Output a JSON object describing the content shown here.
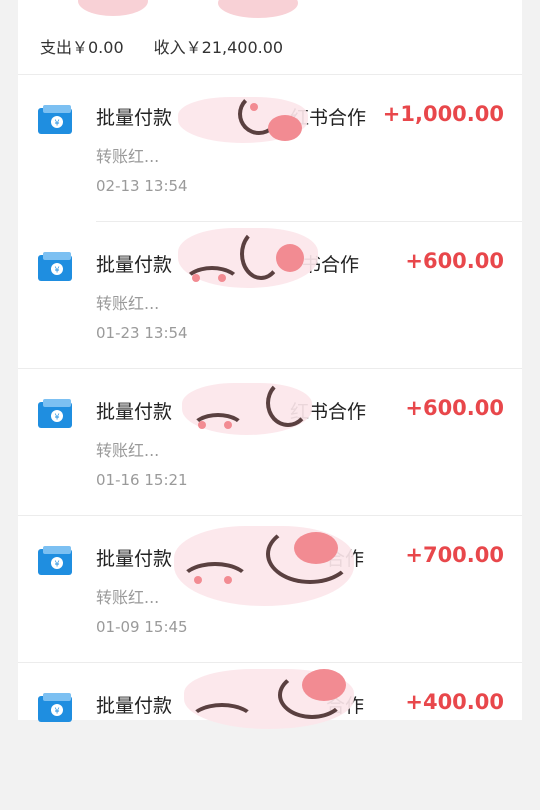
{
  "summary": {
    "expense_label": "支出￥0.00",
    "income_label": "收入￥21,400.00"
  },
  "transactions": [
    {
      "title": "批量付款",
      "title_end": "红书合作",
      "amount": "+1,000.00",
      "subtitle": "转账红...",
      "time": "02-13 13:54",
      "icon": "wallet-icon"
    },
    {
      "title": "批量付款",
      "title_end": "书合作",
      "amount": "+600.00",
      "subtitle": "转账红...",
      "time": "01-23 13:54",
      "icon": "wallet-icon"
    },
    {
      "title": "批量付款",
      "title_end": "红书合作",
      "amount": "+600.00",
      "subtitle": "转账红...",
      "time": "01-16 15:21",
      "icon": "wallet-icon"
    },
    {
      "title": "批量付款",
      "title_end": "合作",
      "amount": "+700.00",
      "subtitle": "转账红...",
      "time": "01-09 15:45",
      "icon": "wallet-icon"
    },
    {
      "title": "批量付款",
      "title_end": "合作",
      "amount": "+400.00",
      "subtitle": "",
      "time": "",
      "icon": "wallet-icon"
    }
  ],
  "colors": {
    "amount": "#e8474b",
    "icon_blue": "#1f8ee0",
    "muted_text": "#9a9a9a"
  }
}
